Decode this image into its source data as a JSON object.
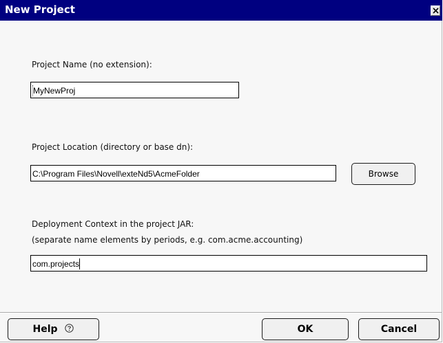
{
  "window": {
    "title": "New Project",
    "close_glyph": "✕"
  },
  "project_name": {
    "label": "Project Name (no extension):",
    "value": "MyNewProj"
  },
  "project_location": {
    "label": "Project Location (directory or base dn):",
    "value": "C:\\Program Files\\Novell\\exteNd5\\AcmeFolder",
    "browse_label": "Browse"
  },
  "deployment_context": {
    "label": "Deployment Context in the project JAR:",
    "hint": "(separate name elements by periods, e.g. com.acme.accounting)",
    "value": "com.projects"
  },
  "buttons": {
    "help_label": "Help",
    "help_icon": "question-circle-icon",
    "ok_label": "OK",
    "cancel_label": "Cancel"
  },
  "colors": {
    "titlebar": "#000080",
    "dialog_background": "#f7f7f7"
  }
}
